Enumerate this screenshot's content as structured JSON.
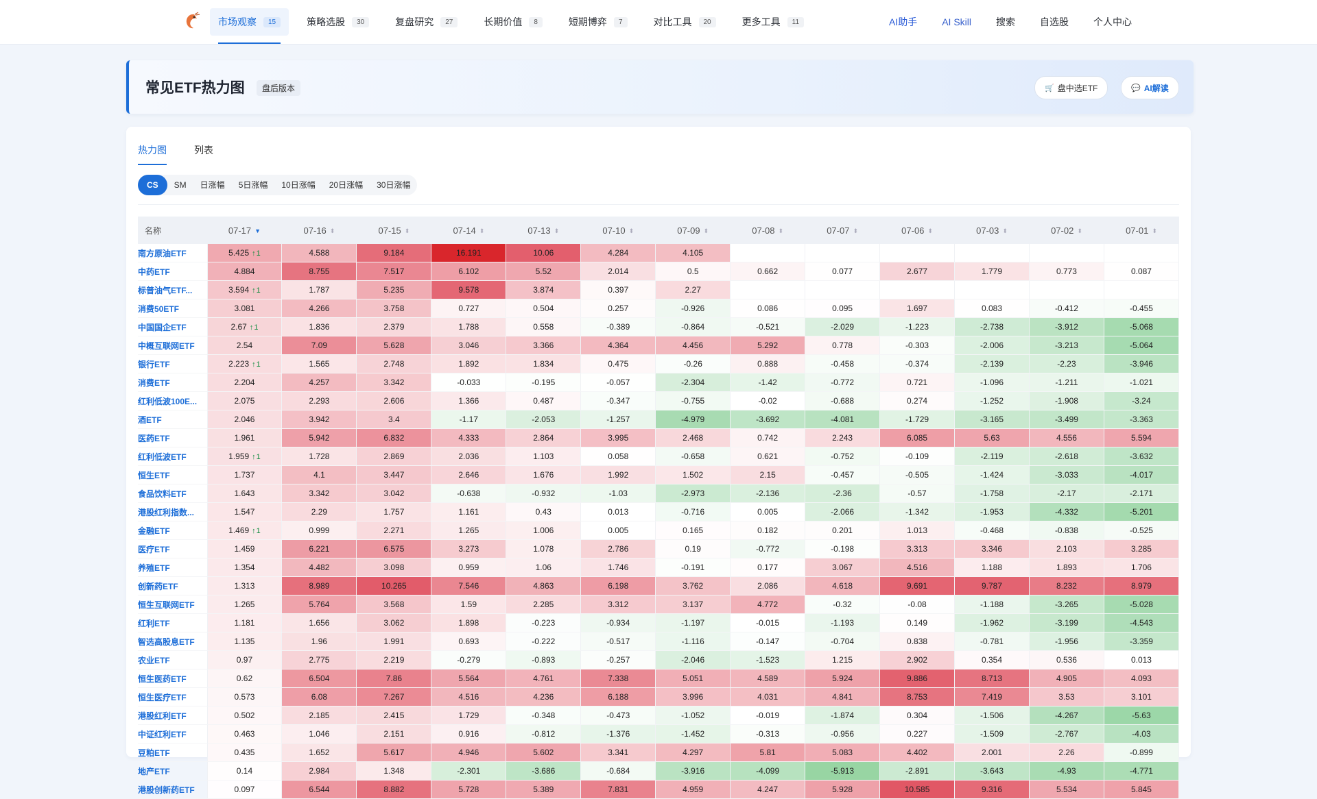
{
  "nav": {
    "items": [
      {
        "label": "市场观察",
        "count": "15",
        "active": true
      },
      {
        "label": "策略选股",
        "count": "30"
      },
      {
        "label": "复盘研究",
        "count": "27"
      },
      {
        "label": "长期价值",
        "count": "8"
      },
      {
        "label": "短期博弈",
        "count": "7"
      },
      {
        "label": "对比工具",
        "count": "20"
      },
      {
        "label": "更多工具",
        "count": "11"
      }
    ],
    "right": [
      "AI助手",
      "AI Skill",
      "搜索",
      "自选股",
      "个人中心"
    ]
  },
  "hero": {
    "title": "常见ETF热力图",
    "badge": "盘后版本",
    "btn_intraday": "盘中选ETF",
    "btn_ai": "AI解读"
  },
  "tabs": [
    "热力图",
    "列表"
  ],
  "segments": [
    "CS",
    "SM",
    "日涨幅",
    "5日涨幅",
    "10日涨幅",
    "20日涨幅",
    "30日涨幅"
  ],
  "colors": {
    "accent": "#1d6ed8",
    "positive": "#e0505f",
    "negative": "#47a866"
  },
  "table": {
    "name_header": "名称",
    "dates": [
      "07-17",
      "07-16",
      "07-15",
      "07-14",
      "07-13",
      "07-10",
      "07-09",
      "07-08",
      "07-07",
      "07-06",
      "07-03",
      "07-02",
      "07-01"
    ],
    "rows": [
      {
        "name": "南方原油ETF",
        "flag": "1",
        "v": [
          5.425,
          4.588,
          9.184,
          16.191,
          10.06,
          4.284,
          4.105,
          null,
          null,
          null,
          null,
          null,
          null
        ]
      },
      {
        "name": "中药ETF",
        "v": [
          4.884,
          8.755,
          7.517,
          6.102,
          5.52,
          2.014,
          0.5,
          0.662,
          0.077,
          2.677,
          1.779,
          0.773,
          0.087
        ]
      },
      {
        "name": "标普油气ETF...",
        "flag": "1",
        "v": [
          3.594,
          1.787,
          5.235,
          9.578,
          3.874,
          0.397,
          2.27,
          null,
          null,
          null,
          null,
          null,
          null
        ]
      },
      {
        "name": "消费50ETF",
        "v": [
          3.081,
          4.266,
          3.758,
          0.727,
          0.504,
          0.257,
          -0.926,
          0.086,
          0.095,
          1.697,
          0.083,
          -0.412,
          -0.455
        ]
      },
      {
        "name": "中国国企ETF",
        "flag": "1",
        "v": [
          2.67,
          1.836,
          2.379,
          1.788,
          0.558,
          -0.389,
          -0.864,
          -0.521,
          -2.029,
          -1.223,
          -2.738,
          -3.912,
          -5.068
        ]
      },
      {
        "name": "中概互联网ETF",
        "v": [
          2.54,
          7.09,
          5.628,
          3.046,
          3.366,
          4.364,
          4.456,
          5.292,
          0.778,
          -0.303,
          -2.006,
          -3.213,
          -5.064
        ]
      },
      {
        "name": "银行ETF",
        "flag": "1",
        "v": [
          2.223,
          1.565,
          2.748,
          1.892,
          1.834,
          0.475,
          -0.26,
          0.888,
          -0.458,
          -0.374,
          -2.139,
          -2.23,
          -3.946
        ]
      },
      {
        "name": "消费ETF",
        "v": [
          2.204,
          4.257,
          3.342,
          -0.033,
          -0.195,
          -0.057,
          -2.304,
          -1.42,
          -0.772,
          0.721,
          -1.096,
          -1.211,
          -1.021
        ]
      },
      {
        "name": "红利低波100E...",
        "v": [
          2.075,
          2.293,
          2.606,
          1.366,
          0.487,
          -0.347,
          -0.755,
          -0.02,
          -0.688,
          0.274,
          -1.252,
          -1.908,
          -3.24
        ]
      },
      {
        "name": "酒ETF",
        "v": [
          2.046,
          3.942,
          3.4,
          -1.17,
          -2.053,
          -1.257,
          -4.979,
          -3.692,
          -4.081,
          -1.729,
          -3.165,
          -3.499,
          -3.363
        ]
      },
      {
        "name": "医药ETF",
        "v": [
          1.961,
          5.942,
          6.832,
          4.333,
          2.864,
          3.995,
          2.468,
          0.742,
          2.243,
          6.085,
          5.63,
          4.556,
          5.594
        ]
      },
      {
        "name": "红利低波ETF",
        "flag": "1",
        "v": [
          1.959,
          1.728,
          2.869,
          2.036,
          1.103,
          0.058,
          -0.658,
          0.621,
          -0.752,
          -0.109,
          -2.119,
          -2.618,
          -3.632
        ]
      },
      {
        "name": "恒生ETF",
        "v": [
          1.737,
          4.1,
          3.447,
          2.646,
          1.676,
          1.992,
          1.502,
          2.15,
          -0.457,
          -0.505,
          -1.424,
          -3.033,
          -4.017
        ]
      },
      {
        "name": "食品饮料ETF",
        "v": [
          1.643,
          3.342,
          3.042,
          -0.638,
          -0.932,
          -1.03,
          -2.973,
          -2.136,
          -2.36,
          -0.57,
          -1.758,
          -2.17,
          -2.171
        ]
      },
      {
        "name": "港股红利指数...",
        "v": [
          1.547,
          2.29,
          1.757,
          1.161,
          0.43,
          0.013,
          -0.716,
          0.005,
          -2.066,
          -1.342,
          -1.953,
          -4.332,
          -5.201
        ]
      },
      {
        "name": "金融ETF",
        "flag": "1",
        "v": [
          1.469,
          0.999,
          2.271,
          1.265,
          1.006,
          0.005,
          0.165,
          0.182,
          0.201,
          1.013,
          -0.468,
          -0.838,
          -0.525
        ]
      },
      {
        "name": "医疗ETF",
        "v": [
          1.459,
          6.221,
          6.575,
          3.273,
          1.078,
          2.786,
          0.19,
          -0.772,
          -0.198,
          3.313,
          3.346,
          2.103,
          3.285
        ]
      },
      {
        "name": "养殖ETF",
        "v": [
          1.354,
          4.482,
          3.098,
          0.959,
          1.06,
          1.746,
          -0.191,
          0.177,
          3.067,
          4.516,
          1.188,
          1.893,
          1.706
        ]
      },
      {
        "name": "创新药ETF",
        "v": [
          1.313,
          8.989,
          10.265,
          7.546,
          4.863,
          6.198,
          3.762,
          2.086,
          4.618,
          9.691,
          9.787,
          8.232,
          8.979
        ]
      },
      {
        "name": "恒生互联网ETF",
        "v": [
          1.265,
          5.764,
          3.568,
          1.59,
          2.285,
          3.312,
          3.137,
          4.772,
          -0.32,
          -0.08,
          -1.188,
          -3.265,
          -5.028
        ]
      },
      {
        "name": "红利ETF",
        "v": [
          1.181,
          1.656,
          3.062,
          1.898,
          -0.223,
          -0.934,
          -1.197,
          -0.015,
          -1.193,
          0.149,
          -1.962,
          -3.199,
          -4.543
        ]
      },
      {
        "name": "智选高股息ETF",
        "v": [
          1.135,
          1.96,
          1.991,
          0.693,
          -0.222,
          -0.517,
          -1.116,
          -0.147,
          -0.704,
          0.838,
          -0.781,
          -1.956,
          -3.359
        ]
      },
      {
        "name": "农业ETF",
        "v": [
          0.97,
          2.775,
          2.219,
          -0.279,
          -0.893,
          -0.257,
          -2.046,
          -1.523,
          1.215,
          2.902,
          0.354,
          0.536,
          0.013
        ]
      },
      {
        "name": "恒生医药ETF",
        "v": [
          0.62,
          6.504,
          7.86,
          5.564,
          4.761,
          7.338,
          5.051,
          4.589,
          5.924,
          9.886,
          8.713,
          4.905,
          4.093
        ]
      },
      {
        "name": "恒生医疗ETF",
        "v": [
          0.573,
          6.08,
          7.267,
          4.516,
          4.236,
          6.188,
          3.996,
          4.031,
          4.841,
          8.753,
          7.419,
          3.53,
          3.101
        ]
      },
      {
        "name": "港股红利ETF",
        "v": [
          0.502,
          2.185,
          2.415,
          1.729,
          -0.348,
          -0.473,
          -1.052,
          -0.019,
          -1.874,
          0.304,
          -1.506,
          -4.267,
          -5.63
        ]
      },
      {
        "name": "中证红利ETF",
        "v": [
          0.463,
          1.046,
          2.151,
          0.916,
          -0.812,
          -1.376,
          -1.452,
          -0.313,
          -0.956,
          0.227,
          -1.509,
          -2.767,
          -4.03
        ]
      },
      {
        "name": "豆粕ETF",
        "v": [
          0.435,
          1.652,
          5.617,
          4.946,
          5.602,
          3.341,
          4.297,
          5.81,
          5.083,
          4.402,
          2.001,
          2.26,
          -0.899
        ]
      },
      {
        "name": "地产ETF",
        "v": [
          0.14,
          2.984,
          1.348,
          -2.301,
          -3.686,
          -0.684,
          -3.916,
          -4.099,
          -5.913,
          -2.891,
          -3.643,
          -4.93,
          -4.771
        ]
      },
      {
        "name": "港股创新药ETF",
        "v": [
          0.097,
          6.544,
          8.882,
          5.728,
          5.389,
          7.831,
          4.959,
          4.247,
          5.928,
          10.585,
          9.316,
          5.534,
          5.845
        ]
      }
    ]
  }
}
